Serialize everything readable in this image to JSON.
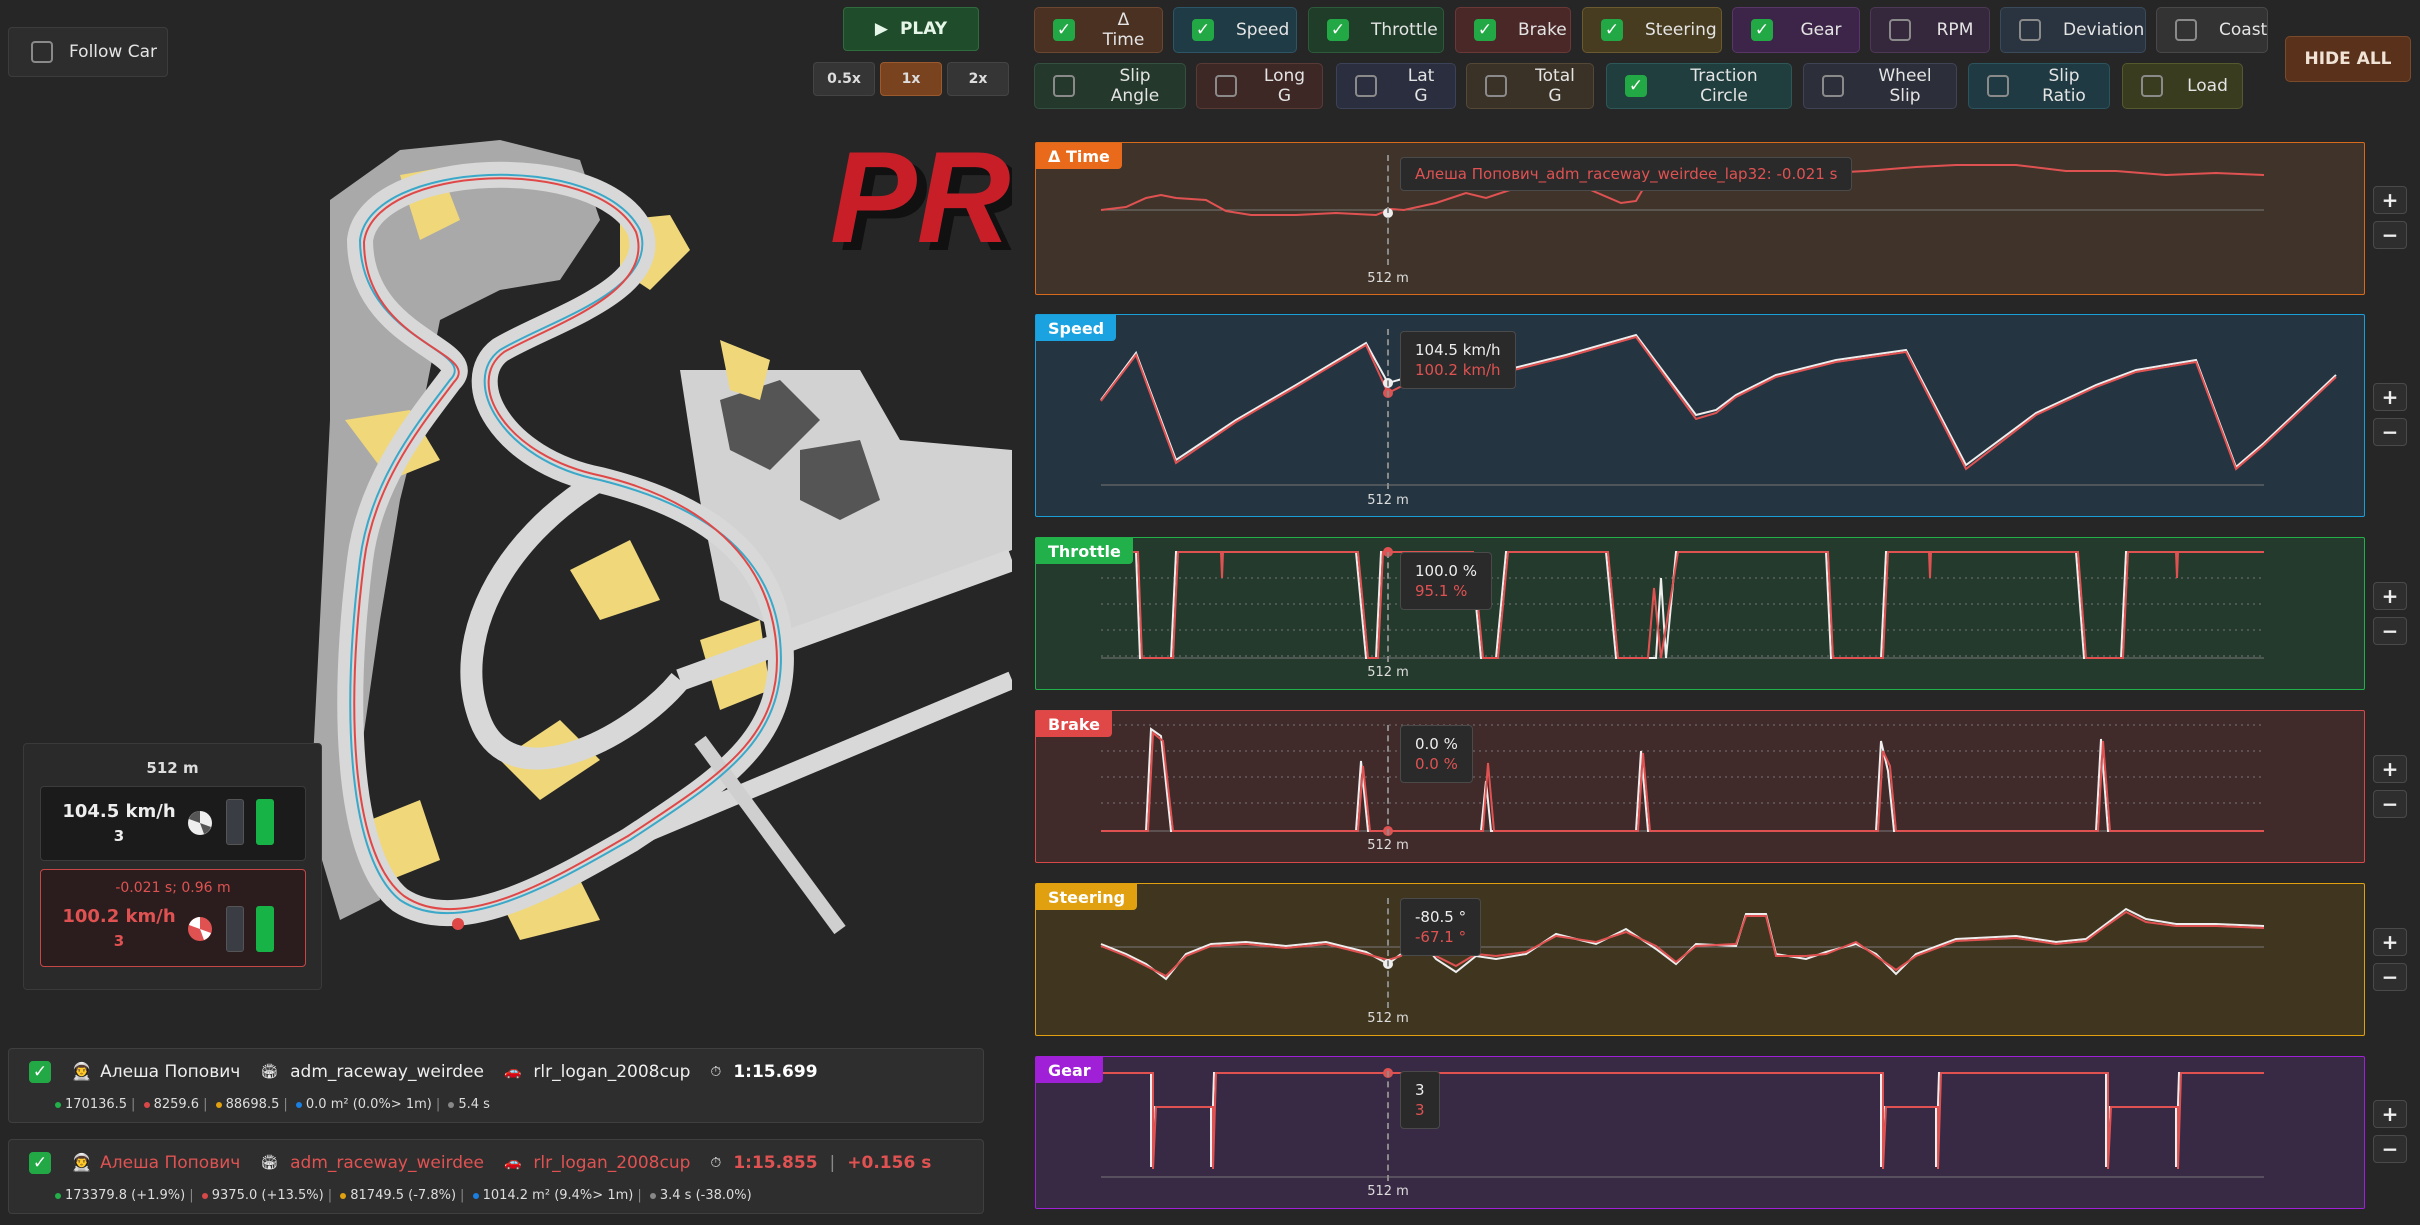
{
  "controls": {
    "follow_car": "Follow Car",
    "play": "PLAY",
    "speeds": [
      "0.5x",
      "1x",
      "2x"
    ],
    "active_speed": "1x",
    "hide_all": "HIDE ALL"
  },
  "toggles": [
    {
      "label": "Δ Time",
      "checked": true
    },
    {
      "label": "Speed",
      "checked": true
    },
    {
      "label": "Throttle",
      "checked": true
    },
    {
      "label": "Brake",
      "checked": true
    },
    {
      "label": "Steering",
      "checked": true
    },
    {
      "label": "Gear",
      "checked": true
    },
    {
      "label": "RPM",
      "checked": false
    },
    {
      "label": "Deviation",
      "checked": false
    },
    {
      "label": "Coast",
      "checked": false
    },
    {
      "label": "Slip Angle",
      "checked": false
    },
    {
      "label": "Long G",
      "checked": false
    },
    {
      "label": "Lat G",
      "checked": false
    },
    {
      "label": "Total G",
      "checked": false
    },
    {
      "label": "Traction Circle",
      "checked": true
    },
    {
      "label": "Wheel Slip",
      "checked": false
    },
    {
      "label": "Slip Ratio",
      "checked": false
    },
    {
      "label": "Load",
      "checked": false
    }
  ],
  "map": {
    "logo_text": "PRO"
  },
  "info": {
    "distance": "512 m",
    "reference": {
      "speed": "104.5 km/h",
      "gear": "3"
    },
    "compare": {
      "delta": "-0.021 s; 0.96 m",
      "speed": "100.2 km/h",
      "gear": "3"
    }
  },
  "laps": [
    {
      "checked": true,
      "driver": "Алеша Попович",
      "track": "adm_raceway_weirdee",
      "car": "rlr_logan_2008cup",
      "time": "1:15.699",
      "delta": "",
      "stats": [
        "170136.5",
        "8259.6",
        "88698.5",
        "0.0 m² (0.0%> 1m)",
        "5.4 s"
      ]
    },
    {
      "checked": true,
      "driver": "Алеша Попович",
      "track": "adm_raceway_weirdee",
      "car": "rlr_logan_2008cup",
      "time": "1:15.855",
      "delta": "+0.156 s",
      "stats": [
        "173379.8 (+1.9%)",
        "9375.0 (+13.5%)",
        "81749.5 (-7.8%)",
        "1014.2 m² (9.4%> 1m)",
        "3.4 s (-38.0%)"
      ]
    }
  ],
  "panels": [
    {
      "title": "Δ Time",
      "marker": "512 m",
      "tip_a": "",
      "tip_b": "Алеша Попович_adm_raceway_weirdee_lap32: -0.021 s"
    },
    {
      "title": "Speed",
      "marker": "512 m",
      "tip_a": "104.5 km/h",
      "tip_b": "100.2 km/h"
    },
    {
      "title": "Throttle",
      "marker": "512 m",
      "tip_a": "100.0 %",
      "tip_b": "95.1 %"
    },
    {
      "title": "Brake",
      "marker": "512 m",
      "tip_a": "0.0 %",
      "tip_b": "0.0 %"
    },
    {
      "title": "Steering",
      "marker": "512 m",
      "tip_a": "-80.5 °",
      "tip_b": "-67.1 °"
    },
    {
      "title": "Gear",
      "marker": "512 m",
      "tip_a": "3",
      "tip_b": "3"
    }
  ],
  "colors": {
    "reference_line": "#e8e8e8",
    "compare_line": "#e05252",
    "delta": "#e86a1a",
    "speed": "#1aa3e0",
    "throttle": "#22b04a",
    "brake": "#d94848",
    "steering": "#e0a010",
    "gear": "#a020d8"
  }
}
